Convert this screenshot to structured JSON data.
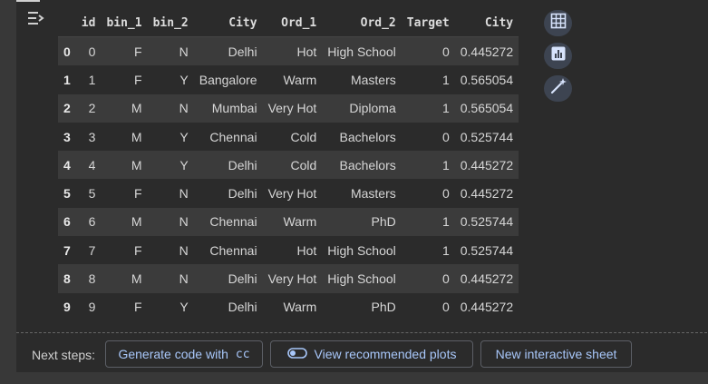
{
  "table": {
    "headers": [
      "",
      "id",
      "bin_1",
      "bin_2",
      "City",
      "Ord_1",
      "Ord_2",
      "Target",
      "City"
    ],
    "rows": [
      [
        "0",
        "0",
        "F",
        "N",
        "Delhi",
        "Hot",
        "High School",
        "0",
        "0.445272"
      ],
      [
        "1",
        "1",
        "F",
        "Y",
        "Bangalore",
        "Warm",
        "Masters",
        "1",
        "0.565054"
      ],
      [
        "2",
        "2",
        "M",
        "N",
        "Mumbai",
        "Very Hot",
        "Diploma",
        "1",
        "0.565054"
      ],
      [
        "3",
        "3",
        "M",
        "Y",
        "Chennai",
        "Cold",
        "Bachelors",
        "0",
        "0.525744"
      ],
      [
        "4",
        "4",
        "M",
        "Y",
        "Delhi",
        "Cold",
        "Bachelors",
        "1",
        "0.445272"
      ],
      [
        "5",
        "5",
        "F",
        "N",
        "Delhi",
        "Very Hot",
        "Masters",
        "0",
        "0.445272"
      ],
      [
        "6",
        "6",
        "M",
        "N",
        "Chennai",
        "Warm",
        "PhD",
        "1",
        "0.525744"
      ],
      [
        "7",
        "7",
        "F",
        "N",
        "Chennai",
        "Hot",
        "High School",
        "1",
        "0.525744"
      ],
      [
        "8",
        "8",
        "M",
        "N",
        "Delhi",
        "Very Hot",
        "High School",
        "0",
        "0.445272"
      ],
      [
        "9",
        "9",
        "F",
        "Y",
        "Delhi",
        "Warm",
        "PhD",
        "0",
        "0.445272"
      ]
    ]
  },
  "side_buttons": [
    {
      "icon": "table-icon"
    },
    {
      "icon": "bar-chart-icon"
    },
    {
      "icon": "magic-wand-icon"
    }
  ],
  "next_steps": {
    "label": "Next steps:",
    "generate_prefix": "Generate code with",
    "generate_code": "cc",
    "plots": "View recommended plots",
    "sheet": "New interactive sheet"
  },
  "colors": {
    "accent": "#a8c7fa",
    "background": "#2b2b2b",
    "row_alt": "#3b3b3b"
  }
}
